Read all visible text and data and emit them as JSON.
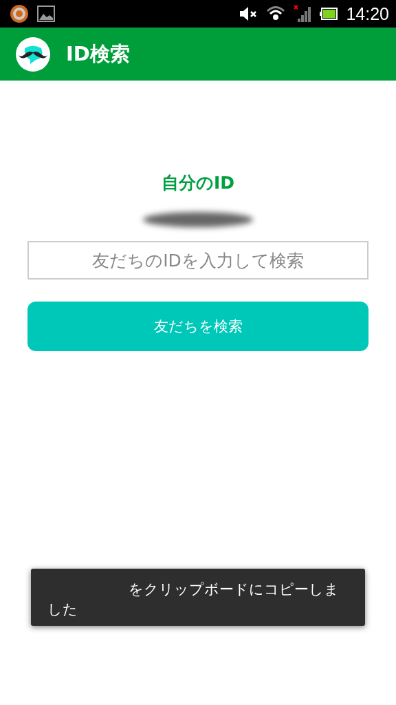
{
  "status_bar": {
    "time": "14:20"
  },
  "app_bar": {
    "title": "ID検索"
  },
  "own_id": {
    "label": "自分のID"
  },
  "search": {
    "placeholder": "友だちのIDを入力して検索"
  },
  "search_button": {
    "label": "友だちを検索"
  },
  "toast": {
    "message": "をクリップボードにコピーしました"
  }
}
